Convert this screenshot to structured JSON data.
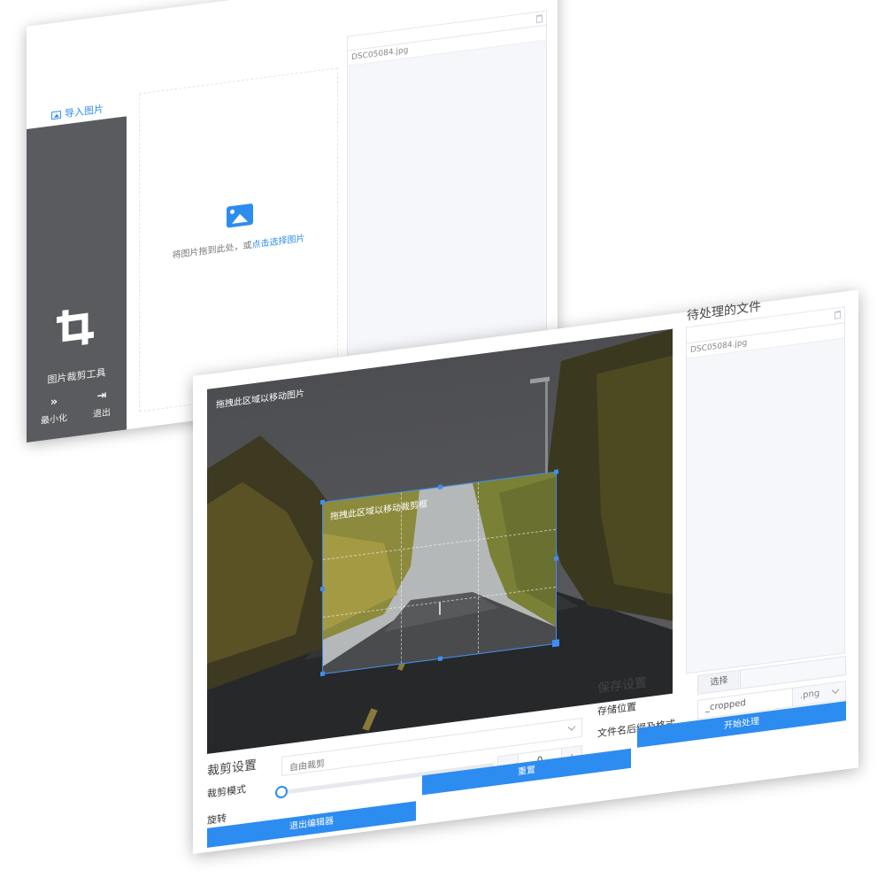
{
  "back_window": {
    "import_label": "导入图片",
    "app_title": "图片裁剪工具",
    "minimize_label": "最小化",
    "exit_label": "退出",
    "drop_text_prefix": "将图片拖到此处，或",
    "drop_text_link": "点击选择图片",
    "file_list": [
      "DSC05084.jpg"
    ]
  },
  "editor": {
    "photo_hint": "拖拽此区域以移动图片",
    "crop_hint": "拖拽此区域以移动裁剪框",
    "crop_settings_title": "裁剪设置",
    "crop_mode_label": "裁剪模式",
    "crop_mode_value": "自由裁剪",
    "rotate_label": "旋转",
    "rotate_value": "0",
    "rotate_minus": "−",
    "rotate_plus": "+",
    "exit_editor_label": "退出编辑器",
    "reset_label": "重置",
    "pending_files_title": "待处理的文件",
    "file_list": [
      "DSC05084.jpg"
    ],
    "save_settings_title": "保存设置",
    "save_location_label": "存储位置",
    "choose_label": "选择",
    "suffix_format_label": "文件名后缀及格式",
    "suffix_value": "_cropped",
    "format_value": ".png",
    "start_label": "开始处理"
  },
  "colors": {
    "accent": "#2d8cf0",
    "sidebar": "#5a5b5e"
  }
}
